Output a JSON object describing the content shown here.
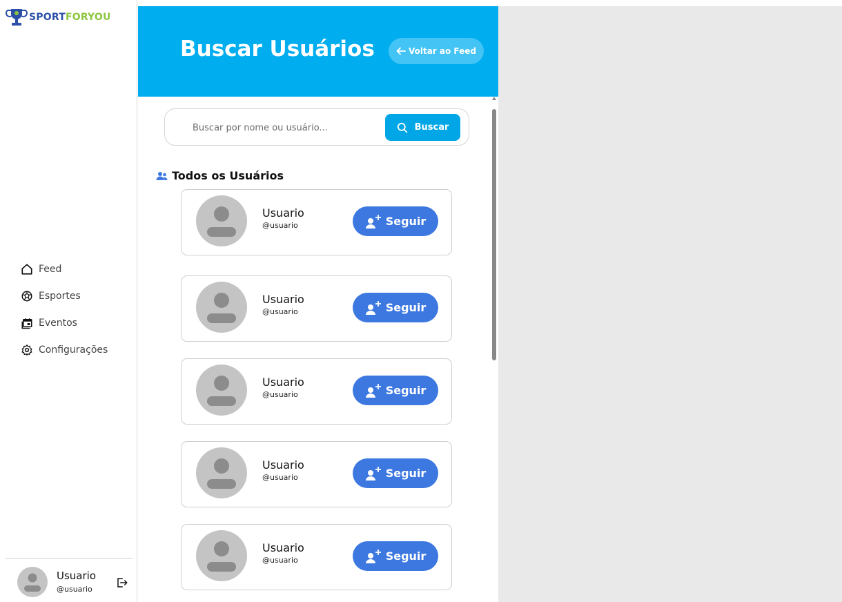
{
  "brand": {
    "part1": "SPORT",
    "part2": "FORYOU"
  },
  "nav": [
    {
      "label": "Feed",
      "icon": "home-icon"
    },
    {
      "label": "Esportes",
      "icon": "soccer-ball-icon"
    },
    {
      "label": "Eventos",
      "icon": "calendar-icon"
    },
    {
      "label": "Configurações",
      "icon": "gear-icon"
    }
  ],
  "current_user": {
    "name": "Usuario",
    "handle": "@usuario"
  },
  "header": {
    "title": "Buscar Usuários",
    "back_label": "Voltar ao Feed"
  },
  "search": {
    "placeholder": "Buscar por nome ou usuário...",
    "button_label": "Buscar"
  },
  "section": {
    "title": "Todos os Usuários"
  },
  "users": [
    {
      "name": "Usuario",
      "handle": "@usuario",
      "follow_label": "Seguir"
    },
    {
      "name": "Usuario",
      "handle": "@usuario",
      "follow_label": "Seguir"
    },
    {
      "name": "Usuario",
      "handle": "@usuario",
      "follow_label": "Seguir"
    },
    {
      "name": "Usuario",
      "handle": "@usuario",
      "follow_label": "Seguir"
    },
    {
      "name": "Usuario",
      "handle": "@usuario",
      "follow_label": "Seguir"
    }
  ],
  "colors": {
    "header": "#00adee",
    "search_button": "#00a6e6",
    "follow_button": "#3d78e0",
    "brand_blue": "#2c4fa8",
    "brand_green": "#8cc63f"
  }
}
